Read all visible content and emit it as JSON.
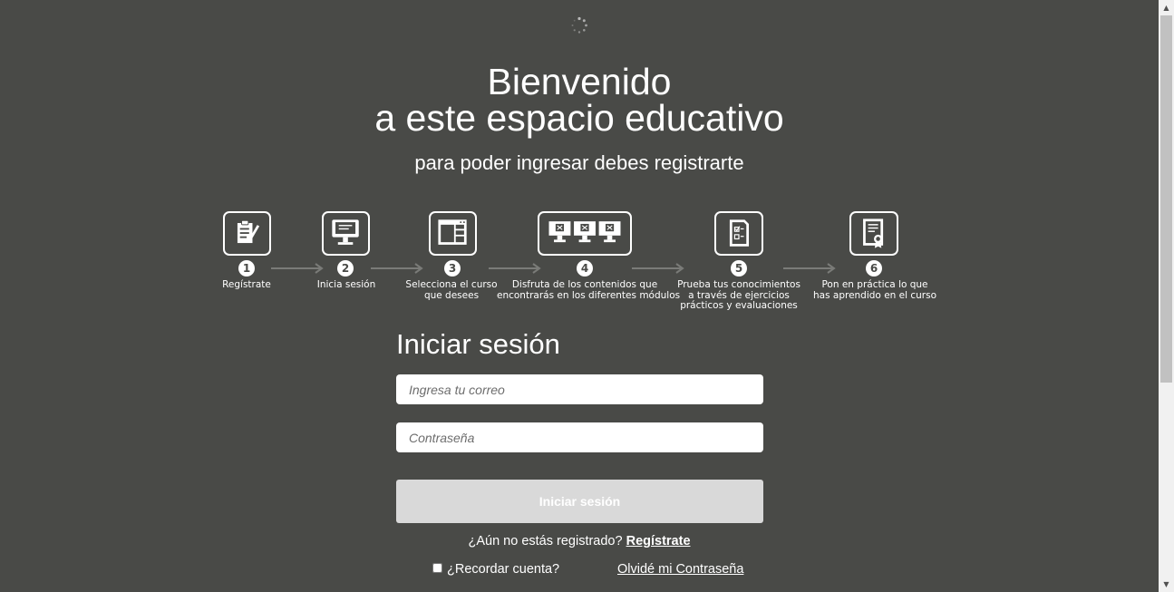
{
  "hero": {
    "title_line1": "Bienvenido",
    "title_line2": "a este espacio educativo",
    "subtitle": "para poder ingresar debes registrarte"
  },
  "steps": [
    {
      "number": "1",
      "label_lines": [
        "Regístrate"
      ],
      "icon": "clipboard-pen-icon"
    },
    {
      "number": "2",
      "label_lines": [
        "Inicia sesión"
      ],
      "icon": "monitor-icon"
    },
    {
      "number": "3",
      "label_lines": [
        "Selecciona el curso",
        "que desees"
      ],
      "icon": "browser-window-icon"
    },
    {
      "number": "4",
      "label_lines": [
        "Disfruta de los contenidos que",
        "encontrarás en los diferentes módulos"
      ],
      "icon": "three-monitors-icon"
    },
    {
      "number": "5",
      "label_lines": [
        "Prueba tus conocimientos",
        "a través de ejercicios",
        "prácticos y evaluaciones"
      ],
      "icon": "checklist-document-icon"
    },
    {
      "number": "6",
      "label_lines": [
        "Pon en práctica lo que",
        "has aprendido en el curso"
      ],
      "icon": "certificate-icon"
    }
  ],
  "login": {
    "title": "Iniciar sesión",
    "email_placeholder": "Ingresa tu correo",
    "password_placeholder": "Contraseña",
    "submit_label": "Iniciar sesión",
    "register_prompt": "¿Aún no estás registrado?",
    "register_link": "Regístrate",
    "remember_label": "¿Recordar cuenta?",
    "forgot_link": "Olvidé mi Contraseña"
  },
  "colors": {
    "background": "#494a47",
    "text": "#ffffff",
    "button_disabled": "#d9d9d9",
    "arrow": "#7a7b78"
  }
}
